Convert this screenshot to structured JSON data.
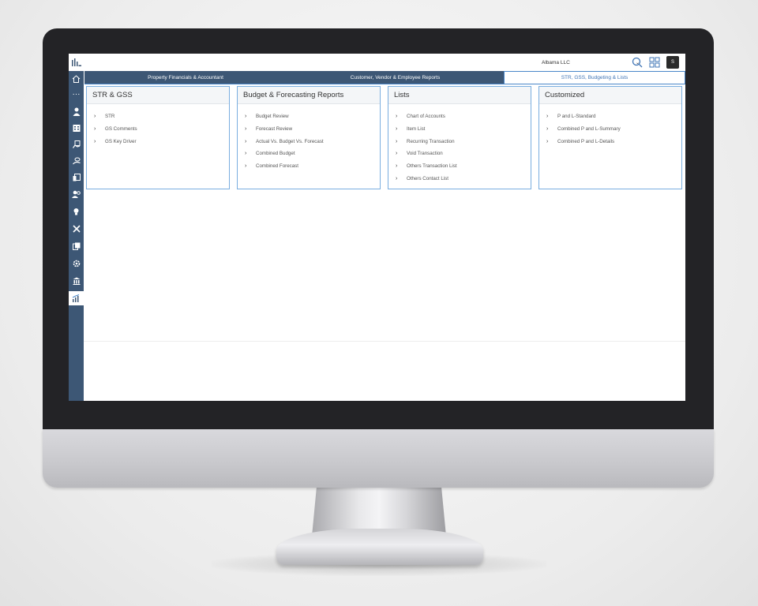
{
  "topbar": {
    "company": "Albama LLC",
    "avatar_letter": "S",
    "icons": [
      "search-icon",
      "grid-icon",
      "chevron-down-icon"
    ]
  },
  "sidebar": {
    "icons": [
      "logo-icon",
      "home-icon",
      "more-icon",
      "person-icon",
      "building-icon",
      "hand-money-icon",
      "coins-hand-icon",
      "report-icon",
      "user-gear-icon",
      "lightbulb-icon",
      "tools-icon",
      "documents-icon",
      "settings-icon",
      "bank-icon",
      "chart-icon"
    ],
    "active": "chart-icon"
  },
  "tabs": [
    {
      "label": "Property Financials & Accountant",
      "active": false
    },
    {
      "label": "Customer, Vendor & Employee Reports",
      "active": false
    },
    {
      "label": "STR, GSS, Budgeting & Lists",
      "active": true
    }
  ],
  "cards": [
    {
      "title": "STR & GSS",
      "items": [
        "STR",
        "GS Comments",
        "GS Key Driver"
      ]
    },
    {
      "title": "Budget & Forecasting Reports",
      "items": [
        "Budget Review",
        "Forecast Review",
        "Actual Vs. Budget Vs. Forecast",
        "Combined Budget",
        "Combined Forecast"
      ]
    },
    {
      "title": "Lists",
      "items": [
        "Chart of Accounts",
        "Item List",
        "Recurring Transaction",
        "Void Transaction",
        "Others Transaction List",
        "Others Contact List"
      ]
    },
    {
      "title": "Customized",
      "items": [
        "P and L-Standard",
        "Combined P and L-Summary",
        "Combined P and L-Details"
      ]
    }
  ],
  "colors": {
    "sidebar": "#3d5775",
    "accent": "#4a87c9",
    "card_border": "#7aaee0"
  }
}
